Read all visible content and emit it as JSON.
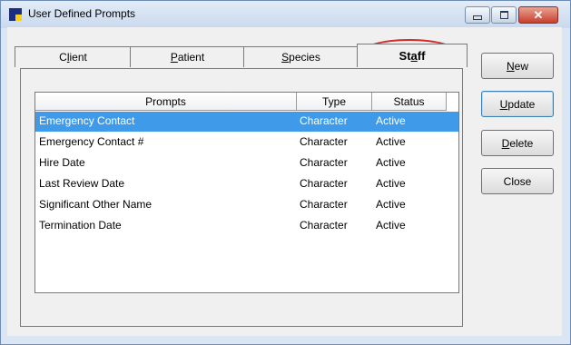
{
  "window": {
    "title": "User Defined Prompts"
  },
  "tabs": [
    {
      "label": "Client",
      "mnemonic": "l"
    },
    {
      "label": "Patient",
      "mnemonic": "P"
    },
    {
      "label": "Species",
      "mnemonic": "S"
    },
    {
      "label": "Staff",
      "mnemonic": "a",
      "active": true
    }
  ],
  "table": {
    "columns": [
      "Prompts",
      "Type",
      "Status"
    ],
    "rows": [
      {
        "prompt": "Emergency Contact",
        "type": "Character",
        "status": "Active",
        "selected": true
      },
      {
        "prompt": "Emergency Contact #",
        "type": "Character",
        "status": "Active"
      },
      {
        "prompt": "Hire Date",
        "type": "Character",
        "status": "Active"
      },
      {
        "prompt": "Last Review Date",
        "type": "Character",
        "status": "Active"
      },
      {
        "prompt": "Significant Other Name",
        "type": "Character",
        "status": "Active"
      },
      {
        "prompt": "Termination Date",
        "type": "Character",
        "status": "Active"
      }
    ]
  },
  "buttons": {
    "new": "New",
    "update": "Update",
    "delete": "Delete",
    "close": "Close"
  },
  "colors": {
    "selection": "#3f9bea",
    "highlight_oval": "#d32a2a"
  }
}
